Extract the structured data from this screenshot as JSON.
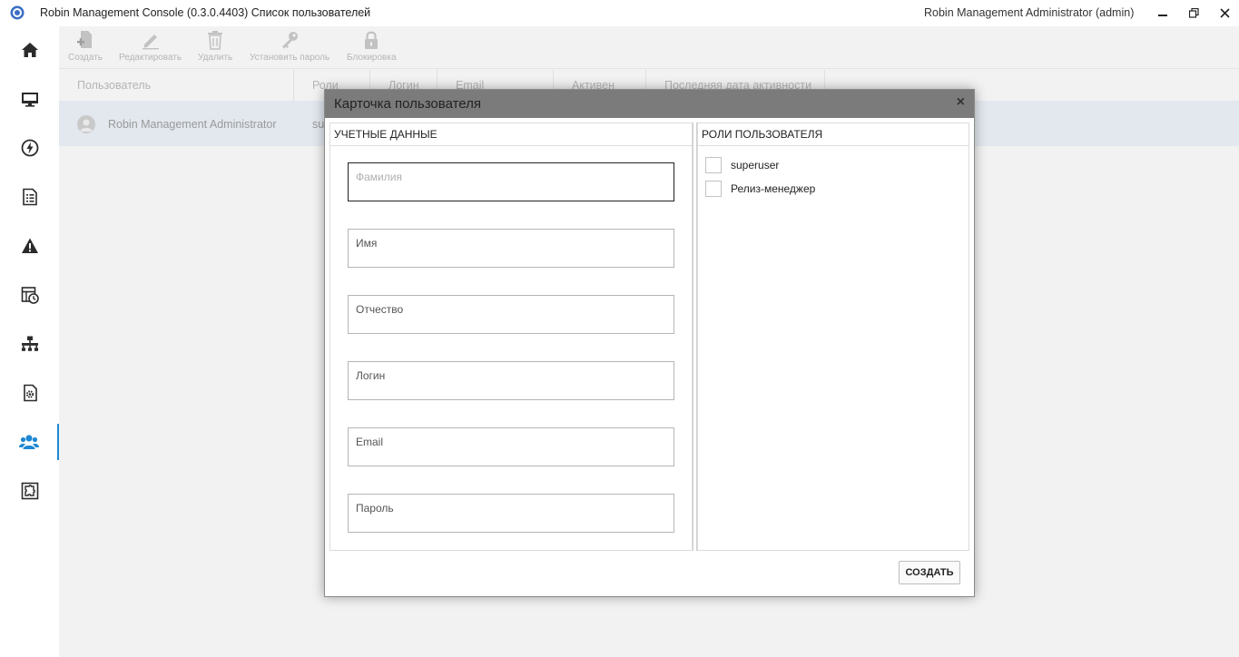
{
  "window": {
    "title": "Robin Management Console (0.3.0.4403) Список пользователей",
    "user": "Robin Management Administrator  (admin)",
    "controls": {
      "minimize": "–",
      "restore": "❐",
      "close": "✕"
    }
  },
  "sidebar": {
    "accent_color": "#1e88d4",
    "icon_color": "#2b2b2b",
    "items": [
      {
        "icon": "home-icon"
      },
      {
        "icon": "monitor-icon"
      },
      {
        "icon": "lightning-icon"
      },
      {
        "icon": "document-list-icon"
      },
      {
        "icon": "warning-icon"
      },
      {
        "icon": "table-clock-icon"
      },
      {
        "icon": "network-icon"
      },
      {
        "icon": "gear-file-icon"
      },
      {
        "icon": "users-icon",
        "active": true
      },
      {
        "icon": "puzzle-icon"
      }
    ]
  },
  "toolbar": {
    "create": "Создать",
    "edit": "Редактировать",
    "delete": "Удалить",
    "set_password": "Установить пароль",
    "block": "Блокировка"
  },
  "grid": {
    "columns": [
      "Пользователь",
      "Роли",
      "Логин",
      "Email",
      "Активен",
      "Последняя дата активности"
    ],
    "rows": [
      {
        "user": "Robin Management Administrator",
        "roles": "su"
      }
    ]
  },
  "modal": {
    "title": "Карточка пользователя",
    "close": "×",
    "left_panel_title": "УЧЕТНЫЕ ДАННЫЕ",
    "right_panel_title": "РОЛИ ПОЛЬЗОВАТЕЛЯ",
    "fields": {
      "last_name": "Фамилия",
      "first_name": "Имя",
      "middle_name": "Отчество",
      "login": "Логин",
      "email": "Email",
      "password": "Пароль"
    },
    "roles": [
      "superuser",
      "Релиз-менеджер"
    ],
    "create_button": "СОЗДАТЬ"
  }
}
